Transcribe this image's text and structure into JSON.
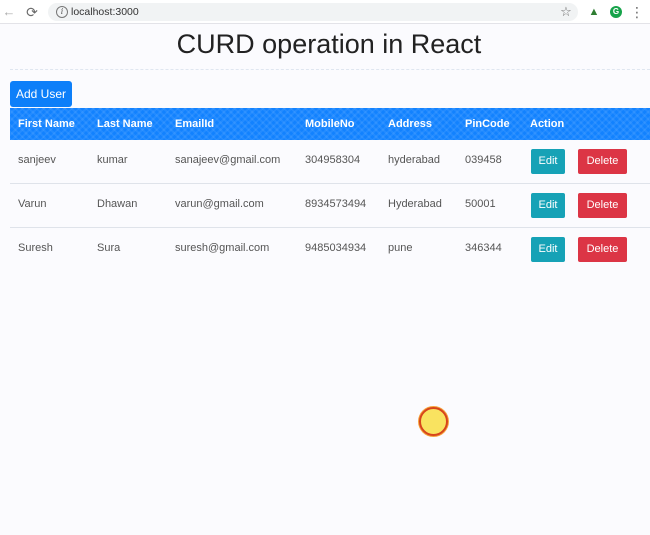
{
  "browser": {
    "url": "localhost:3000",
    "icons": {
      "back": "←",
      "reload": "⟳",
      "star": "☆",
      "flask": "▲",
      "g": "G",
      "menu": "⋮"
    }
  },
  "page": {
    "title": "CURD operation in React",
    "add_button": "Add User"
  },
  "table": {
    "headers": [
      "First Name",
      "Last Name",
      "EmailId",
      "MobileNo",
      "Address",
      "PinCode",
      "Action"
    ],
    "rows": [
      {
        "first": "sanjeev",
        "last": "kumar",
        "email": "sanajeev@gmail.com",
        "mobile": "304958304",
        "address": "hyderabad",
        "pin": "039458",
        "edit": "Edit",
        "delete": "Delete"
      },
      {
        "first": "Varun",
        "last": "Dhawan",
        "email": "varun@gmail.com",
        "mobile": "8934573494",
        "address": "Hyderabad",
        "pin": "50001",
        "edit": "Edit",
        "delete": "Delete"
      },
      {
        "first": "Suresh",
        "last": "Sura",
        "email": "suresh@gmail.com",
        "mobile": "9485034934",
        "address": "pune",
        "pin": "346344",
        "edit": "Edit",
        "delete": "Delete"
      }
    ]
  },
  "colors": {
    "primary": "#0d7ff9",
    "header": "#1282ff",
    "edit": "#16a2b6",
    "delete": "#dc3545"
  }
}
